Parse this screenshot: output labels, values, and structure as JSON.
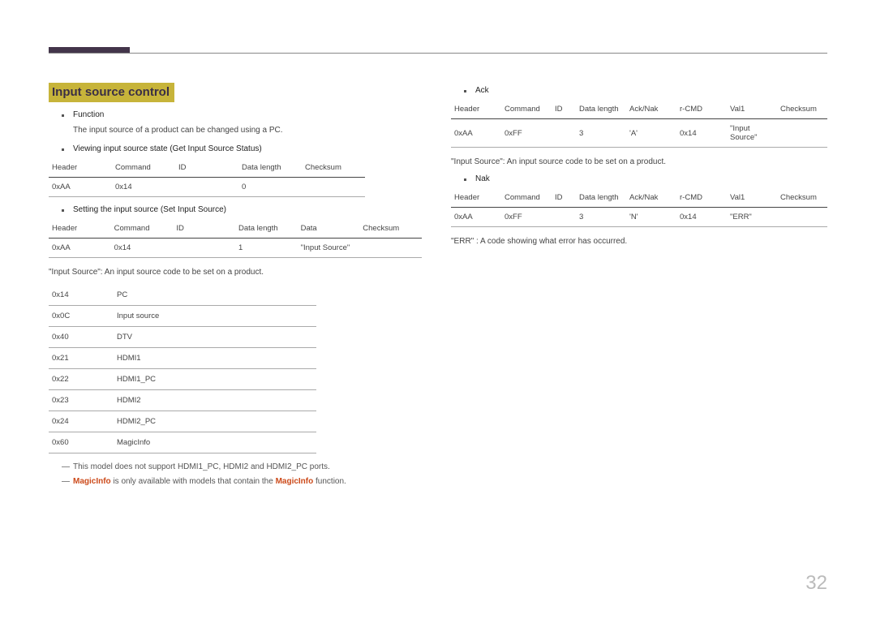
{
  "page_number": "32",
  "section_title": "Input source control",
  "left": {
    "function_label": "Function",
    "function_desc": "The input source of a product can be changed using a PC.",
    "viewing_label": "Viewing input source state (Get Input Source Status)",
    "table_get": {
      "headers": [
        "Header",
        "Command",
        "ID",
        "Data length",
        "Checksum"
      ],
      "row": [
        "0xAA",
        "0x14",
        "",
        "0",
        ""
      ]
    },
    "setting_label": "Setting the input source (Set Input Source)",
    "table_set": {
      "headers": [
        "Header",
        "Command",
        "ID",
        "Data length",
        "Data",
        "Checksum"
      ],
      "row": [
        "0xAA",
        "0x14",
        "",
        "1",
        "\"Input Source\"",
        ""
      ]
    },
    "input_source_note": "\"Input Source\": An input source code to be set on a product.",
    "source_codes": [
      [
        "0x14",
        "PC"
      ],
      [
        "0x0C",
        "Input source"
      ],
      [
        "0x40",
        "DTV"
      ],
      [
        "0x21",
        "HDMI1"
      ],
      [
        "0x22",
        "HDMI1_PC"
      ],
      [
        "0x23",
        "HDMI2"
      ],
      [
        "0x24",
        "HDMI2_PC"
      ],
      [
        "0x60",
        "MagicInfo"
      ]
    ],
    "footnote1": "This model does not support HDMI1_PC, HDMI2 and HDMI2_PC ports.",
    "footnote2_pre": "MagicInfo",
    "footnote2_mid": " is only available with models that contain the ",
    "footnote2_bold": "MagicInfo",
    "footnote2_post": " function."
  },
  "right": {
    "ack_label": "Ack",
    "table_ack": {
      "headers": [
        "Header",
        "Command",
        "ID",
        "Data length",
        "Ack/Nak",
        "r-CMD",
        "Val1",
        "Checksum"
      ],
      "row": [
        "0xAA",
        "0xFF",
        "",
        "3",
        "'A'",
        "0x14",
        "\"Input Source\"",
        ""
      ]
    },
    "ack_note": "\"Input Source\": An input source code to be set on a product.",
    "nak_label": "Nak",
    "table_nak": {
      "headers": [
        "Header",
        "Command",
        "ID",
        "Data length",
        "Ack/Nak",
        "r-CMD",
        "Val1",
        "Checksum"
      ],
      "row": [
        "0xAA",
        "0xFF",
        "",
        "3",
        "'N'",
        "0x14",
        "\"ERR\"",
        ""
      ]
    },
    "err_note": "\"ERR\" : A code showing what error has occurred."
  }
}
